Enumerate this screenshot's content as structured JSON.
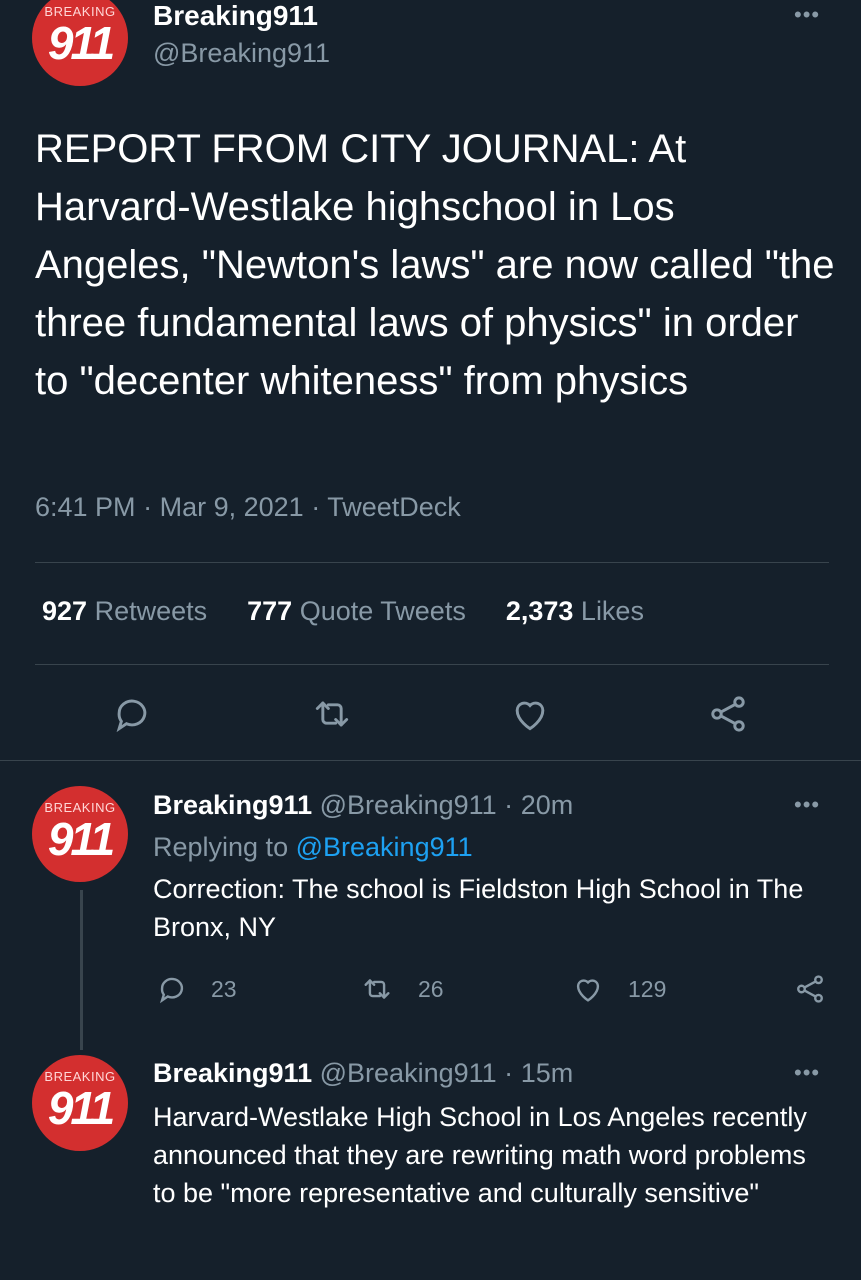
{
  "main_tweet": {
    "avatar": {
      "top_text": "BREAKING",
      "number": "911"
    },
    "name": "Breaking911",
    "handle": "@Breaking911",
    "text": "REPORT FROM CITY JOURNAL: At Harvard-Westlake highschool in Los Angeles, \"Newton's laws\" are now called \"the three fundamental laws of physics\" in order to \"decenter whiteness\" from physics",
    "time": "6:41 PM",
    "date": "Mar 9, 2021",
    "source": "TweetDeck",
    "sep": "·",
    "stats": {
      "retweets_count": "927",
      "retweets_label": "Retweets",
      "quotes_count": "777",
      "quotes_label": "Quote Tweets",
      "likes_count": "2,373",
      "likes_label": "Likes"
    }
  },
  "replies": [
    {
      "avatar": {
        "top_text": "BREAKING",
        "number": "911"
      },
      "name": "Breaking911",
      "handle": "@Breaking911",
      "age": "20m",
      "replying_to_label": "Replying to",
      "replying_to_handle": "@Breaking911",
      "text": "Correction: The school is Fieldston High School in The Bronx, NY",
      "reply_count": "23",
      "retweet_count": "26",
      "like_count": "129"
    },
    {
      "avatar": {
        "top_text": "BREAKING",
        "number": "911"
      },
      "name": "Breaking911",
      "handle": "@Breaking911",
      "age": "15m",
      "text": "Harvard-Westlake High School in Los Angeles recently announced that they are rewriting math word problems to be \"more representative and culturally sensitive\""
    }
  ],
  "icons": {
    "reply": "comment-icon",
    "retweet": "retweet-icon",
    "like": "heart-icon",
    "share": "share-icon",
    "more": "more-options-icon"
  },
  "colors": {
    "background": "#15202b",
    "muted": "#8899a6",
    "link": "#1da1f2",
    "divider": "#38444d",
    "avatar": "#d32f2f"
  }
}
